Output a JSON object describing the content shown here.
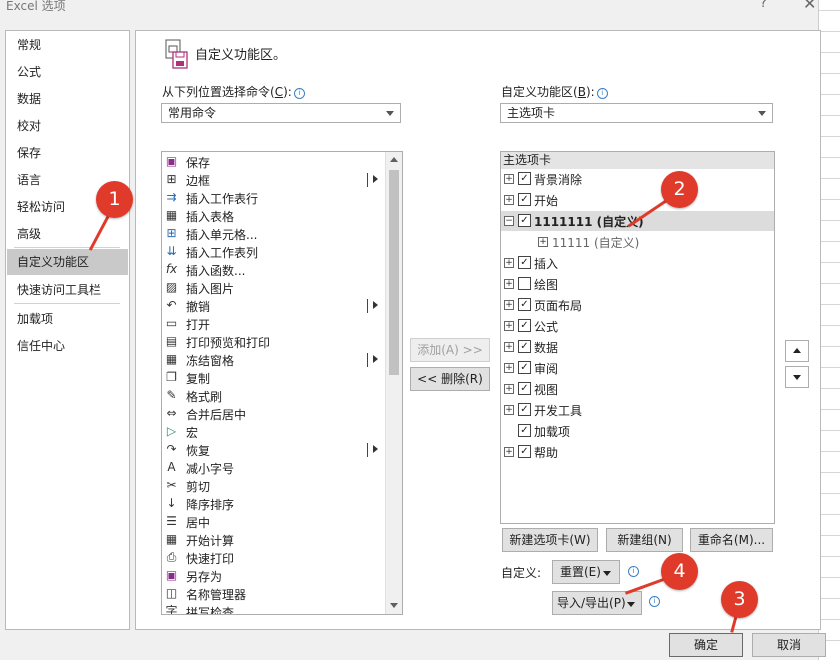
{
  "window": {
    "title": "Excel 选项",
    "help": "?",
    "close": "✕"
  },
  "nav": {
    "items": [
      {
        "label": "常规"
      },
      {
        "label": "公式"
      },
      {
        "label": "数据"
      },
      {
        "label": "校对"
      },
      {
        "label": "保存"
      },
      {
        "label": "语言"
      },
      {
        "label": "轻松访问"
      },
      {
        "label": "高级"
      },
      {
        "label": "自定义功能区",
        "selected": true
      },
      {
        "label": "快速访问工具栏"
      },
      {
        "label": "加载项"
      },
      {
        "label": "信任中心"
      }
    ]
  },
  "heading": "自定义功能区。",
  "left": {
    "label": "从下列位置选择命令",
    "key": "C",
    "select_value": "常用命令",
    "commands": [
      {
        "icon": "save-icon",
        "glyph": "▣",
        "label": "保存",
        "sub": false
      },
      {
        "icon": "border-icon",
        "glyph": "⊞",
        "label": "边框",
        "sub": true
      },
      {
        "icon": "insert-row-icon",
        "glyph": "⇉",
        "label": "插入工作表行",
        "sub": false
      },
      {
        "icon": "insert-table-icon",
        "glyph": "▦",
        "label": "插入表格",
        "sub": false
      },
      {
        "icon": "insert-cell-icon",
        "glyph": "⊞",
        "label": "插入单元格...",
        "sub": false
      },
      {
        "icon": "insert-column-icon",
        "glyph": "⇊",
        "label": "插入工作表列",
        "sub": false
      },
      {
        "icon": "function-icon",
        "glyph": "fx",
        "label": "插入函数...",
        "sub": false
      },
      {
        "icon": "picture-icon",
        "glyph": "▨",
        "label": "插入图片",
        "sub": false
      },
      {
        "icon": "undo-icon",
        "glyph": "↶",
        "label": "撤销",
        "sub": true
      },
      {
        "icon": "open-folder-icon",
        "glyph": "▭",
        "label": "打开",
        "sub": false
      },
      {
        "icon": "print-preview-icon",
        "glyph": "▤",
        "label": "打印预览和打印",
        "sub": false
      },
      {
        "icon": "freeze-panes-icon",
        "glyph": "▦",
        "label": "冻结窗格",
        "sub": true
      },
      {
        "icon": "copy-icon",
        "glyph": "❐",
        "label": "复制",
        "sub": false
      },
      {
        "icon": "format-painter-icon",
        "glyph": "✎",
        "label": "格式刷",
        "sub": false
      },
      {
        "icon": "merge-center-icon",
        "glyph": "⇔",
        "label": "合并后居中",
        "sub": false
      },
      {
        "icon": "macro-icon",
        "glyph": "▷",
        "label": "宏",
        "sub": false
      },
      {
        "icon": "redo-icon",
        "glyph": "↷",
        "label": "恢复",
        "sub": true
      },
      {
        "icon": "decrease-font-icon",
        "glyph": "A",
        "label": "减小字号",
        "sub": false
      },
      {
        "icon": "cut-icon",
        "glyph": "✂",
        "label": "剪切",
        "sub": false
      },
      {
        "icon": "sort-desc-icon",
        "glyph": "↓",
        "label": "降序排序",
        "sub": false
      },
      {
        "icon": "center-align-icon",
        "glyph": "☰",
        "label": "居中",
        "sub": false
      },
      {
        "icon": "calculate-icon",
        "glyph": "▦",
        "label": "开始计算",
        "sub": false
      },
      {
        "icon": "quick-print-icon",
        "glyph": "⎙",
        "label": "快速打印",
        "sub": false
      },
      {
        "icon": "save-as-icon",
        "glyph": "▣",
        "label": "另存为",
        "sub": false
      },
      {
        "icon": "name-manager-icon",
        "glyph": "◫",
        "label": "名称管理器",
        "sub": false
      },
      {
        "icon": "spelling-icon",
        "glyph": "字",
        "label": "拼写检查",
        "sub": false
      }
    ]
  },
  "middle": {
    "add": "添加(A) >>",
    "remove": "<< 删除(R)"
  },
  "right": {
    "label": "自定义功能区",
    "key": "B",
    "select_value": "主选项卡",
    "tree_header": "主选项卡",
    "nodes": [
      {
        "label": "背景消除",
        "level": 0,
        "exp": "+",
        "checked": true
      },
      {
        "label": "开始",
        "level": 0,
        "exp": "+",
        "checked": true
      },
      {
        "label": "1111111 (自定义)",
        "level": 0,
        "exp": "−",
        "checked": true,
        "selected": true,
        "bold": true
      },
      {
        "label": "11111 (自定义)",
        "level": 1,
        "exp": "+",
        "checked": null
      },
      {
        "label": "插入",
        "level": 0,
        "exp": "+",
        "checked": true
      },
      {
        "label": "绘图",
        "level": 0,
        "exp": "+",
        "checked": false
      },
      {
        "label": "页面布局",
        "level": 0,
        "exp": "+",
        "checked": true
      },
      {
        "label": "公式",
        "level": 0,
        "exp": "+",
        "checked": true
      },
      {
        "label": "数据",
        "level": 0,
        "exp": "+",
        "checked": true
      },
      {
        "label": "审阅",
        "level": 0,
        "exp": "+",
        "checked": true
      },
      {
        "label": "视图",
        "level": 0,
        "exp": "+",
        "checked": true
      },
      {
        "label": "开发工具",
        "level": 0,
        "exp": "+",
        "checked": true
      },
      {
        "label": "加载项",
        "level": 0,
        "exp": "",
        "checked": true
      },
      {
        "label": "帮助",
        "level": 0,
        "exp": "+",
        "checked": true
      }
    ],
    "new_tab": "新建选项卡(W)",
    "new_group": "新建组(N)",
    "rename": "重命名(M)...",
    "customize_label": "自定义:",
    "reset": "重置(E)",
    "import_export": "导入/导出(P)"
  },
  "footer": {
    "ok": "确定",
    "cancel": "取消"
  },
  "annotations": [
    "1",
    "2",
    "3",
    "4"
  ],
  "colors": {
    "badge": "#e03a2a",
    "selected_nav": "#c9c9c9"
  }
}
